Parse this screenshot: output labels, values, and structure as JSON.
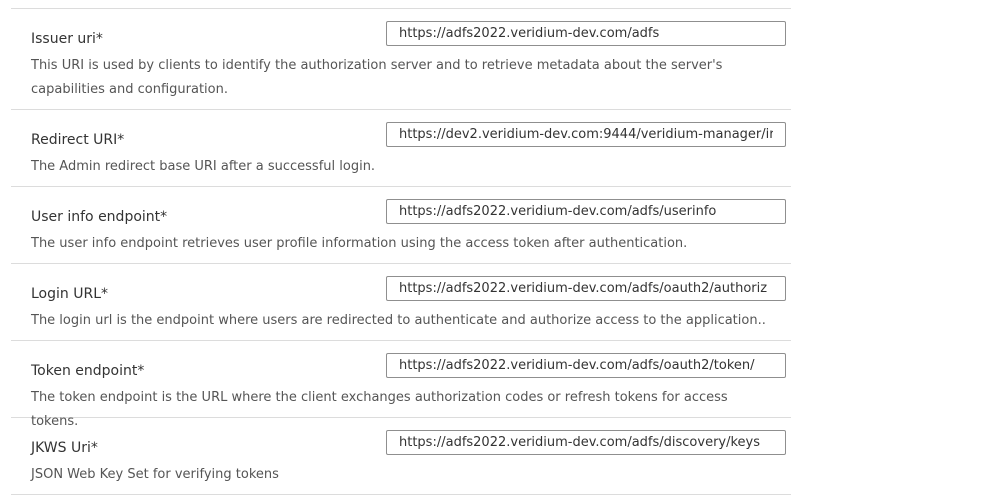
{
  "fields": [
    {
      "label": "Issuer uri*",
      "value": "https://adfs2022.veridium-dev.com/adfs",
      "description": "This URI is used by clients to identify the authorization server and to retrieve metadata about the server's capabilities and configuration."
    },
    {
      "label": "Redirect URI*",
      "value": "https://dev2.veridium-dev.com:9444/veridium-manager/ir",
      "description": "The Admin redirect base URI after a successful login."
    },
    {
      "label": "User info endpoint*",
      "value": "https://adfs2022.veridium-dev.com/adfs/userinfo",
      "description": "The user info endpoint retrieves user profile information using the access token after authentication."
    },
    {
      "label": "Login URL*",
      "value": "https://adfs2022.veridium-dev.com/adfs/oauth2/authoriz",
      "description": "The login url is the endpoint where users are redirected to authenticate and authorize access to the application.."
    },
    {
      "label": "Token endpoint*",
      "value": "https://adfs2022.veridium-dev.com/adfs/oauth2/token/",
      "description": "The token endpoint is the URL where the client exchanges authorization codes or refresh tokens for access tokens."
    },
    {
      "label": "JKWS Uri*",
      "value": "https://adfs2022.veridium-dev.com/adfs/discovery/keys",
      "description": "JSON Web Key Set for verifying tokens"
    }
  ]
}
